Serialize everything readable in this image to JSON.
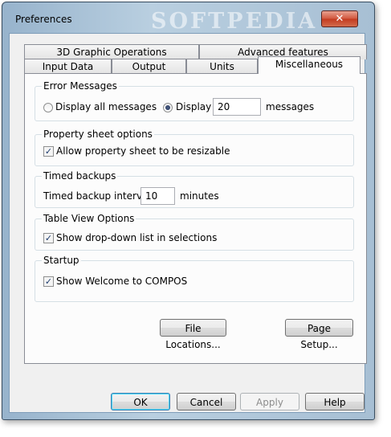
{
  "window": {
    "title": "Preferences",
    "watermark": "SOFTPEDIA",
    "close_glyph": "✕"
  },
  "tabs_row1": [
    {
      "label": "3D Graphic Operations"
    },
    {
      "label": "Advanced features"
    }
  ],
  "tabs_row2": [
    {
      "label": "Input Data"
    },
    {
      "label": "Output"
    },
    {
      "label": "Units"
    },
    {
      "label": "Miscellaneous",
      "selected": true
    }
  ],
  "error_messages": {
    "title": "Error Messages",
    "option_all": "Display all messages",
    "option_display": "Display",
    "selected": "display",
    "count_value": "20",
    "count_suffix": "messages"
  },
  "property_sheet": {
    "title": "Property sheet options",
    "resizable_label": "Allow property sheet to be resizable",
    "resizable_checked": true
  },
  "timed_backups": {
    "title": "Timed backups",
    "interval_label": "Timed backup interval",
    "interval_value": "10",
    "interval_suffix": "minutes"
  },
  "table_view": {
    "title": "Table View Options",
    "dropdown_label": "Show drop-down list in selections",
    "dropdown_checked": true
  },
  "startup": {
    "title": "Startup",
    "welcome_label": "Show Welcome to COMPOS",
    "welcome_checked": true
  },
  "panel_buttons": {
    "file_locations": "File Locations...",
    "page_setup": "Page Setup..."
  },
  "dialog_buttons": {
    "ok": "OK",
    "cancel": "Cancel",
    "apply": "Apply",
    "help": "Help"
  },
  "check_glyph": "✓"
}
